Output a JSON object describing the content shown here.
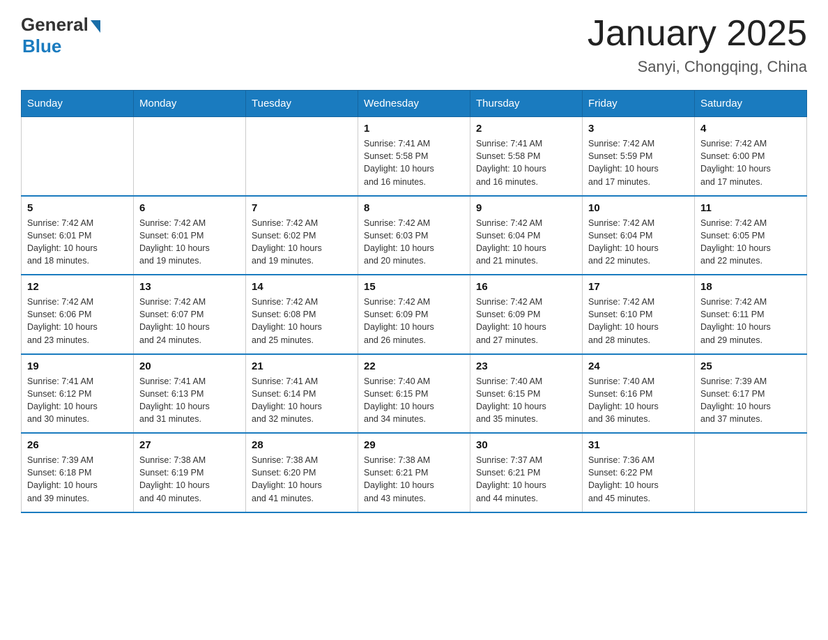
{
  "logo": {
    "general": "General",
    "blue": "Blue"
  },
  "title": "January 2025",
  "subtitle": "Sanyi, Chongqing, China",
  "days_of_week": [
    "Sunday",
    "Monday",
    "Tuesday",
    "Wednesday",
    "Thursday",
    "Friday",
    "Saturday"
  ],
  "weeks": [
    [
      {
        "day": "",
        "info": ""
      },
      {
        "day": "",
        "info": ""
      },
      {
        "day": "",
        "info": ""
      },
      {
        "day": "1",
        "info": "Sunrise: 7:41 AM\nSunset: 5:58 PM\nDaylight: 10 hours\nand 16 minutes."
      },
      {
        "day": "2",
        "info": "Sunrise: 7:41 AM\nSunset: 5:58 PM\nDaylight: 10 hours\nand 16 minutes."
      },
      {
        "day": "3",
        "info": "Sunrise: 7:42 AM\nSunset: 5:59 PM\nDaylight: 10 hours\nand 17 minutes."
      },
      {
        "day": "4",
        "info": "Sunrise: 7:42 AM\nSunset: 6:00 PM\nDaylight: 10 hours\nand 17 minutes."
      }
    ],
    [
      {
        "day": "5",
        "info": "Sunrise: 7:42 AM\nSunset: 6:01 PM\nDaylight: 10 hours\nand 18 minutes."
      },
      {
        "day": "6",
        "info": "Sunrise: 7:42 AM\nSunset: 6:01 PM\nDaylight: 10 hours\nand 19 minutes."
      },
      {
        "day": "7",
        "info": "Sunrise: 7:42 AM\nSunset: 6:02 PM\nDaylight: 10 hours\nand 19 minutes."
      },
      {
        "day": "8",
        "info": "Sunrise: 7:42 AM\nSunset: 6:03 PM\nDaylight: 10 hours\nand 20 minutes."
      },
      {
        "day": "9",
        "info": "Sunrise: 7:42 AM\nSunset: 6:04 PM\nDaylight: 10 hours\nand 21 minutes."
      },
      {
        "day": "10",
        "info": "Sunrise: 7:42 AM\nSunset: 6:04 PM\nDaylight: 10 hours\nand 22 minutes."
      },
      {
        "day": "11",
        "info": "Sunrise: 7:42 AM\nSunset: 6:05 PM\nDaylight: 10 hours\nand 22 minutes."
      }
    ],
    [
      {
        "day": "12",
        "info": "Sunrise: 7:42 AM\nSunset: 6:06 PM\nDaylight: 10 hours\nand 23 minutes."
      },
      {
        "day": "13",
        "info": "Sunrise: 7:42 AM\nSunset: 6:07 PM\nDaylight: 10 hours\nand 24 minutes."
      },
      {
        "day": "14",
        "info": "Sunrise: 7:42 AM\nSunset: 6:08 PM\nDaylight: 10 hours\nand 25 minutes."
      },
      {
        "day": "15",
        "info": "Sunrise: 7:42 AM\nSunset: 6:09 PM\nDaylight: 10 hours\nand 26 minutes."
      },
      {
        "day": "16",
        "info": "Sunrise: 7:42 AM\nSunset: 6:09 PM\nDaylight: 10 hours\nand 27 minutes."
      },
      {
        "day": "17",
        "info": "Sunrise: 7:42 AM\nSunset: 6:10 PM\nDaylight: 10 hours\nand 28 minutes."
      },
      {
        "day": "18",
        "info": "Sunrise: 7:42 AM\nSunset: 6:11 PM\nDaylight: 10 hours\nand 29 minutes."
      }
    ],
    [
      {
        "day": "19",
        "info": "Sunrise: 7:41 AM\nSunset: 6:12 PM\nDaylight: 10 hours\nand 30 minutes."
      },
      {
        "day": "20",
        "info": "Sunrise: 7:41 AM\nSunset: 6:13 PM\nDaylight: 10 hours\nand 31 minutes."
      },
      {
        "day": "21",
        "info": "Sunrise: 7:41 AM\nSunset: 6:14 PM\nDaylight: 10 hours\nand 32 minutes."
      },
      {
        "day": "22",
        "info": "Sunrise: 7:40 AM\nSunset: 6:15 PM\nDaylight: 10 hours\nand 34 minutes."
      },
      {
        "day": "23",
        "info": "Sunrise: 7:40 AM\nSunset: 6:15 PM\nDaylight: 10 hours\nand 35 minutes."
      },
      {
        "day": "24",
        "info": "Sunrise: 7:40 AM\nSunset: 6:16 PM\nDaylight: 10 hours\nand 36 minutes."
      },
      {
        "day": "25",
        "info": "Sunrise: 7:39 AM\nSunset: 6:17 PM\nDaylight: 10 hours\nand 37 minutes."
      }
    ],
    [
      {
        "day": "26",
        "info": "Sunrise: 7:39 AM\nSunset: 6:18 PM\nDaylight: 10 hours\nand 39 minutes."
      },
      {
        "day": "27",
        "info": "Sunrise: 7:38 AM\nSunset: 6:19 PM\nDaylight: 10 hours\nand 40 minutes."
      },
      {
        "day": "28",
        "info": "Sunrise: 7:38 AM\nSunset: 6:20 PM\nDaylight: 10 hours\nand 41 minutes."
      },
      {
        "day": "29",
        "info": "Sunrise: 7:38 AM\nSunset: 6:21 PM\nDaylight: 10 hours\nand 43 minutes."
      },
      {
        "day": "30",
        "info": "Sunrise: 7:37 AM\nSunset: 6:21 PM\nDaylight: 10 hours\nand 44 minutes."
      },
      {
        "day": "31",
        "info": "Sunrise: 7:36 AM\nSunset: 6:22 PM\nDaylight: 10 hours\nand 45 minutes."
      },
      {
        "day": "",
        "info": ""
      }
    ]
  ]
}
